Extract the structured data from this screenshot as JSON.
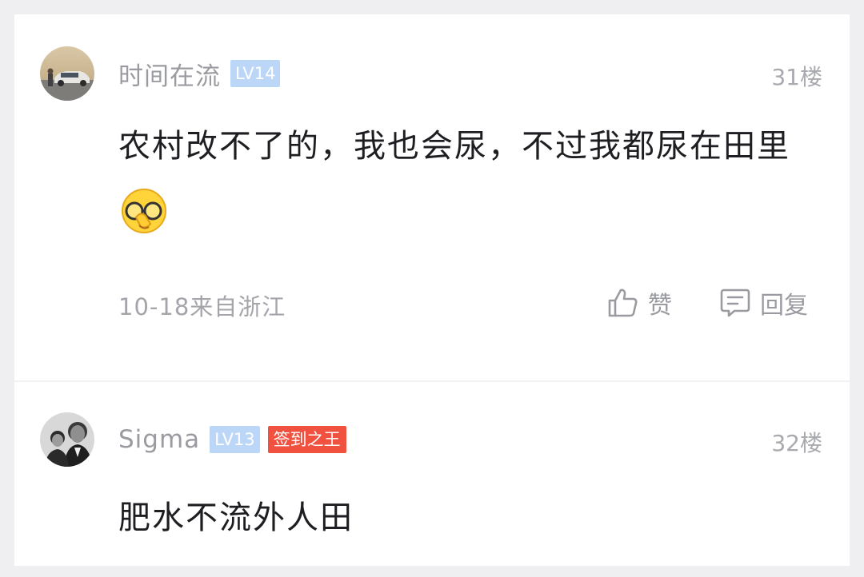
{
  "comments": [
    {
      "username": "时间在流",
      "level": "LV14",
      "floor": "31楼",
      "content": "农村改不了的，我也会尿，不过我都尿在田里",
      "emoji": "covering-eyes-emoji",
      "meta": "10-18来自浙江",
      "like_label": "赞",
      "reply_label": "回复"
    },
    {
      "username": "Sigma",
      "level": "LV13",
      "title_badge": "签到之王",
      "floor": "32楼",
      "content": "肥水不流外人田"
    }
  ],
  "colors": {
    "page_bg": "#efeff1",
    "card_bg": "#ffffff",
    "level_badge": "#bcd6f7",
    "title_badge": "#f0523f",
    "username": "#9a9ba1",
    "content": "#1e1e22"
  },
  "icons": [
    "thumbs-up-icon",
    "comment-bubble-icon"
  ]
}
